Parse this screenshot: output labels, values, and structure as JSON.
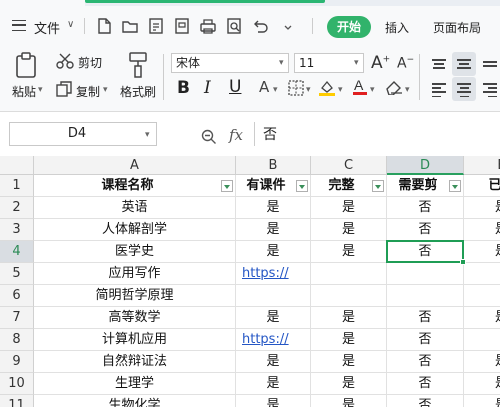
{
  "menubar": {
    "file_label": "文件",
    "tabs": [
      {
        "label": "开始",
        "active": true
      },
      {
        "label": "插入",
        "active": false
      },
      {
        "label": "页面布局",
        "active": false
      }
    ],
    "quick_access_icons": [
      "new-file-icon",
      "open-file-icon",
      "export-pdf-icon",
      "print-icon",
      "print-preview-icon",
      "undo-icon"
    ]
  },
  "ribbon": {
    "paste_label": "粘贴",
    "cut_label": "剪切",
    "copy_label": "复制",
    "format_painter_label": "格式刷",
    "font_name": "宋体",
    "font_size": "11",
    "accent_color": "#31b36b",
    "font_color": "#e02020",
    "highlight_color": "#ffcc00"
  },
  "formulabar": {
    "cell_ref": "D4",
    "fx_label": "fx",
    "value": "否"
  },
  "grid": {
    "columns": [
      "A",
      "B",
      "C",
      "D",
      "E"
    ],
    "selected_column": "D",
    "selected_row": "4",
    "rows": [
      {
        "num": "1",
        "cells": [
          "课程名称",
          "有课件",
          "完整",
          "需要剪",
          "已后"
        ]
      },
      {
        "num": "2",
        "cells": [
          "英语",
          "是",
          "是",
          "否",
          "是"
        ]
      },
      {
        "num": "3",
        "cells": [
          "人体解剖学",
          "是",
          "是",
          "否",
          "是"
        ]
      },
      {
        "num": "4",
        "cells": [
          "医学史",
          "是",
          "是",
          "否",
          "是"
        ]
      },
      {
        "num": "5",
        "cells": [
          "应用写作",
          "https://",
          "",
          "",
          ""
        ]
      },
      {
        "num": "6",
        "cells": [
          "简明哲学原理",
          "",
          "",
          "",
          ""
        ]
      },
      {
        "num": "7",
        "cells": [
          "高等数学",
          "是",
          "是",
          "否",
          "是"
        ]
      },
      {
        "num": "8",
        "cells": [
          "计算机应用",
          "https://",
          "是",
          "否",
          ""
        ]
      },
      {
        "num": "9",
        "cells": [
          "自然辩证法",
          "是",
          "是",
          "否",
          "是"
        ]
      },
      {
        "num": "10",
        "cells": [
          "生理学",
          "是",
          "是",
          "否",
          "是"
        ]
      },
      {
        "num": "11",
        "cells": [
          "生物化学",
          "是",
          "是",
          "否",
          "是"
        ]
      }
    ]
  }
}
